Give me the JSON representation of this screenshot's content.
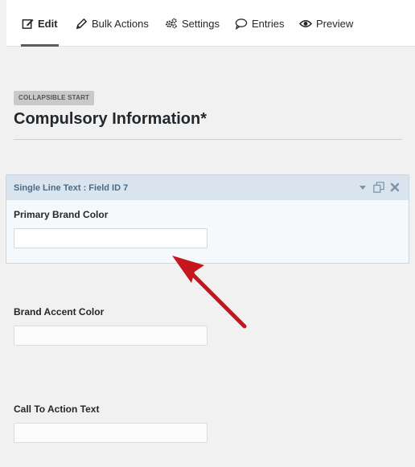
{
  "tabs": [
    {
      "label": "Edit",
      "icon": "edit-icon",
      "active": true
    },
    {
      "label": "Bulk Actions",
      "icon": "pencil-icon"
    },
    {
      "label": "Settings",
      "icon": "gears-icon"
    },
    {
      "label": "Entries",
      "icon": "speech-bubble-icon"
    },
    {
      "label": "Preview",
      "icon": "eye-icon"
    }
  ],
  "section": {
    "badge": "COLLAPSIBLE START",
    "title": "Compulsory Information*"
  },
  "selected_field": {
    "header": "Single Line Text : Field ID 7",
    "label": "Primary Brand Color",
    "value": ""
  },
  "fields": [
    {
      "label": "Brand Accent Color",
      "value": ""
    },
    {
      "label": "Call To Action Text",
      "value": ""
    }
  ],
  "colors": {
    "accent_arrow": "#c4161c",
    "header_bg": "#d9e4ee",
    "header_text": "#4d6a85"
  }
}
